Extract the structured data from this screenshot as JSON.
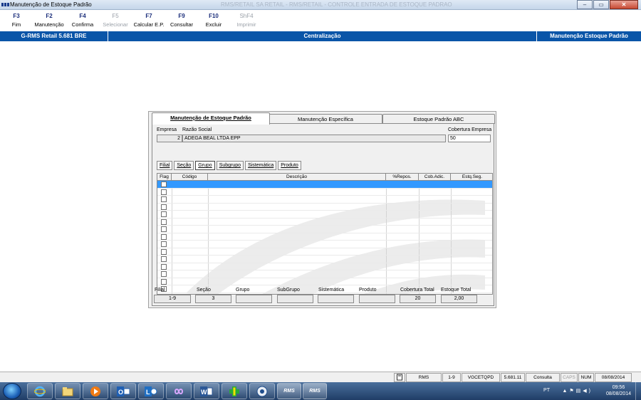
{
  "window": {
    "title": "Manutenção de Estoque Padrão",
    "ghost_title": "RMS/RETAIL SA RETAIL - RMS/RETAIL - CONTROLE ENTRADA DE ESTOQUE PADRAO",
    "min_label": "–",
    "max_label": "▭",
    "close_label": "✕"
  },
  "fkeys": [
    {
      "key": "F3",
      "label": "Fim",
      "enabled": true
    },
    {
      "key": "F2",
      "label": "Manutenção",
      "enabled": true
    },
    {
      "key": "F4",
      "label": "Confirma",
      "enabled": true
    },
    {
      "key": "F5",
      "label": "Selecionar",
      "enabled": false
    },
    {
      "key": "F7",
      "label": "Calcular E.P.",
      "enabled": true
    },
    {
      "key": "F9",
      "label": "Consultar",
      "enabled": true
    },
    {
      "key": "F10",
      "label": "Excluir",
      "enabled": true
    },
    {
      "key": "ShF4",
      "label": "Imprimir",
      "enabled": false
    }
  ],
  "infobar": {
    "left": "G-RMS Retail 5.681 BRE",
    "center": "Centralização",
    "right": "Manutenção Estoque Padrão"
  },
  "tabs": [
    {
      "label": "Manutenção de Estoque Padrão",
      "active": true
    },
    {
      "label": "Manutenção Específica",
      "active": false
    },
    {
      "label": "Estoque Padrão ABC",
      "active": false
    }
  ],
  "empresa": {
    "label_empresa": "Empresa",
    "label_razao": "Razão Social",
    "label_cobertura": "Cobertura Empresa",
    "empresa_value": "2",
    "razao_value": "ADEGA BEAL LTDA EPP",
    "cobertura_value": "50"
  },
  "subtabs": [
    {
      "label": "Filial",
      "active": false
    },
    {
      "label": "Seção",
      "active": false
    },
    {
      "label": "Grupo",
      "active": true
    },
    {
      "label": "Subgrupo",
      "active": false
    },
    {
      "label": "Sistemática",
      "active": false
    },
    {
      "label": "Produto",
      "active": false
    }
  ],
  "grid": {
    "columns": [
      "Flag",
      "Código",
      "Descrição",
      "%Repos.",
      "Cob.Adic.",
      "Estq.Seg."
    ],
    "row_count": 15,
    "selected_row": 0
  },
  "totals": [
    {
      "label": "Filial",
      "value": "1-9"
    },
    {
      "label": "Seção",
      "value": "3"
    },
    {
      "label": "Grupo",
      "value": ""
    },
    {
      "label": "SubGrupo",
      "value": ""
    },
    {
      "label": "Sistemática",
      "value": ""
    },
    {
      "label": "Produto",
      "value": ""
    },
    {
      "label": "Cobertura Total",
      "value": "20"
    },
    {
      "label": "Estoque Total",
      "value": "2,00"
    }
  ],
  "statusbar": {
    "system": "RMS",
    "filial": "1-9",
    "program": "VGCETQPD",
    "version": "5.681.11",
    "mode": "Consulta",
    "caps": "CAPS",
    "num": "NUM",
    "date": "08/08/2014"
  },
  "taskbar": {
    "items": [
      "internet-explorer",
      "file-explorer",
      "media-player",
      "outlook",
      "lync",
      "app-infinity",
      "word",
      "cross-app",
      "app-round",
      "rms-1",
      "rms-2"
    ],
    "rms_label": "RMS",
    "lang": "PT",
    "time": "09:56",
    "date": "08/08/2014"
  }
}
